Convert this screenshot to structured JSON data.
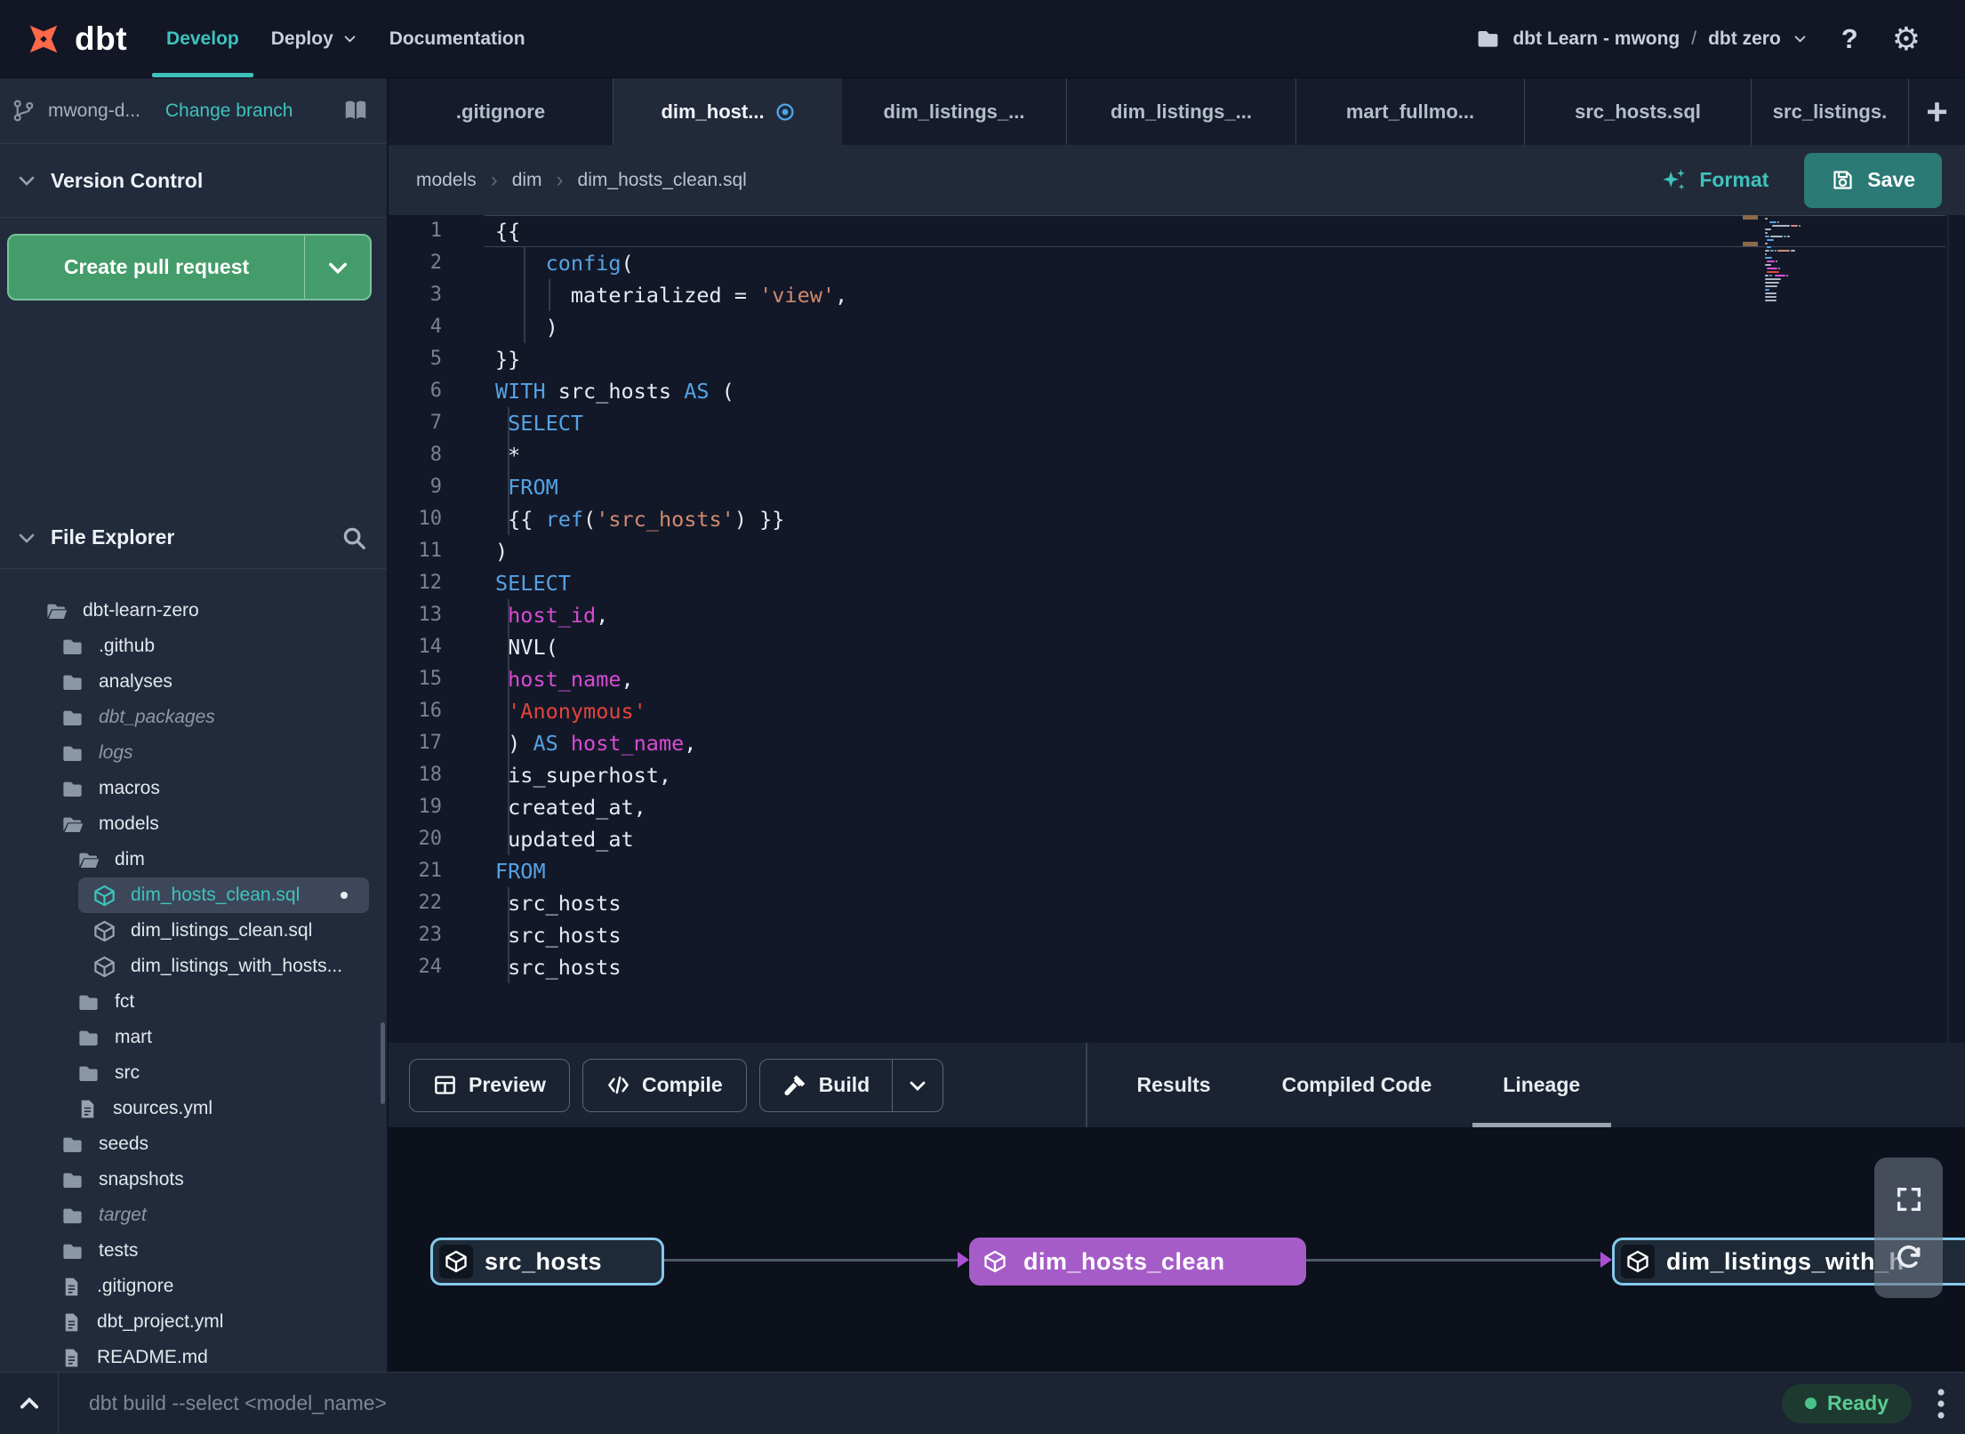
{
  "topbar": {
    "logo_text": "dbt",
    "nav": [
      {
        "label": "Develop",
        "active": true,
        "caret": false
      },
      {
        "label": "Deploy",
        "active": false,
        "caret": true
      },
      {
        "label": "Documentation",
        "active": false,
        "caret": false
      }
    ],
    "project": {
      "workspace": "dbt Learn - mwong",
      "separator": "/",
      "environment": "dbt zero"
    },
    "help_label": "?",
    "gear_glyph": "⚙"
  },
  "sidebar": {
    "branch": {
      "name": "mwong-d...",
      "change_branch_label": "Change branch"
    },
    "version_control": {
      "title": "Version Control",
      "create_pr_label": "Create pull request"
    },
    "file_explorer": {
      "title": "File Explorer",
      "tree": [
        {
          "label": "dbt-learn-zero",
          "icon": "folder-open",
          "level": 0
        },
        {
          "label": ".github",
          "icon": "folder",
          "level": 1
        },
        {
          "label": "analyses",
          "icon": "folder",
          "level": 1
        },
        {
          "label": "dbt_packages",
          "icon": "folder",
          "level": 1,
          "muted": true
        },
        {
          "label": "logs",
          "icon": "folder",
          "level": 1,
          "muted": true
        },
        {
          "label": "macros",
          "icon": "folder",
          "level": 1
        },
        {
          "label": "models",
          "icon": "folder-open",
          "level": 1
        },
        {
          "label": "dim",
          "icon": "folder-open",
          "level": 2
        },
        {
          "label": "dim_hosts_clean.sql",
          "icon": "model",
          "level": 3,
          "selected": true,
          "modified": true
        },
        {
          "label": "dim_listings_clean.sql",
          "icon": "model",
          "level": 3
        },
        {
          "label": "dim_listings_with_hosts...",
          "icon": "model",
          "level": 3
        },
        {
          "label": "fct",
          "icon": "folder",
          "level": 2
        },
        {
          "label": "mart",
          "icon": "folder",
          "level": 2
        },
        {
          "label": "src",
          "icon": "folder",
          "level": 2
        },
        {
          "label": "sources.yml",
          "icon": "file",
          "level": 2
        },
        {
          "label": "seeds",
          "icon": "folder",
          "level": 1
        },
        {
          "label": "snapshots",
          "icon": "folder",
          "level": 1
        },
        {
          "label": "target",
          "icon": "folder",
          "level": 1,
          "muted": true
        },
        {
          "label": "tests",
          "icon": "folder",
          "level": 1
        },
        {
          "label": ".gitignore",
          "icon": "file",
          "level": 1
        },
        {
          "label": "dbt_project.yml",
          "icon": "file",
          "level": 1
        },
        {
          "label": "README.md",
          "icon": "file",
          "level": 1
        }
      ]
    }
  },
  "tabs": {
    "items": [
      {
        "label": ".gitignore"
      },
      {
        "label": "dim_host...",
        "active": true,
        "dirty": true
      },
      {
        "label": "dim_listings_..."
      },
      {
        "label": "dim_listings_..."
      },
      {
        "label": "mart_fullmo..."
      },
      {
        "label": "src_hosts.sql"
      },
      {
        "label": "src_listings."
      }
    ],
    "add_label": "+"
  },
  "breadcrumb": {
    "parts": [
      "models",
      "dim",
      "dim_hosts_clean.sql"
    ],
    "separator": "›"
  },
  "actions": {
    "format_label": "Format",
    "save_label": "Save"
  },
  "editor": {
    "lines": [
      [
        [
          "{{",
          "p"
        ]
      ],
      [
        [
          "    ",
          "p"
        ],
        [
          "config",
          "k"
        ],
        [
          "(",
          "p"
        ]
      ],
      [
        [
          "      ",
          "p"
        ],
        [
          "materialized = ",
          "p"
        ],
        [
          "'view'",
          "s"
        ],
        [
          ",",
          "p"
        ]
      ],
      [
        [
          "    )",
          "p"
        ]
      ],
      [
        [
          "}}",
          "p"
        ]
      ],
      [
        [
          "WITH",
          "k"
        ],
        [
          " src_hosts ",
          "p"
        ],
        [
          "AS",
          "k"
        ],
        [
          " (",
          "p"
        ]
      ],
      [
        [
          " ",
          "p"
        ],
        [
          "SELECT",
          "k"
        ]
      ],
      [
        [
          " *",
          "p"
        ]
      ],
      [
        [
          " ",
          "p"
        ],
        [
          "FROM",
          "k"
        ]
      ],
      [
        [
          " {{ ",
          "p"
        ],
        [
          "ref",
          "k"
        ],
        [
          "(",
          "p"
        ],
        [
          "'src_hosts'",
          "s"
        ],
        [
          ") }}",
          "p"
        ]
      ],
      [
        [
          ")",
          "p"
        ]
      ],
      [
        [
          "SELECT",
          "k"
        ]
      ],
      [
        [
          " ",
          "p"
        ],
        [
          "host_id",
          "i"
        ],
        [
          ",",
          "p"
        ]
      ],
      [
        [
          " NVL(",
          "p"
        ]
      ],
      [
        [
          " ",
          "p"
        ],
        [
          "host_name",
          "i"
        ],
        [
          ",",
          "p"
        ]
      ],
      [
        [
          " ",
          "p"
        ],
        [
          "'Anonymous'",
          "r"
        ]
      ],
      [
        [
          " ) ",
          "p"
        ],
        [
          "AS",
          "k"
        ],
        [
          " ",
          "p"
        ],
        [
          "host_name",
          "i"
        ],
        [
          ",",
          "p"
        ]
      ],
      [
        [
          " is_superhost,",
          "p"
        ]
      ],
      [
        [
          " created_at,",
          "p"
        ]
      ],
      [
        [
          " updated_at",
          "p"
        ]
      ],
      [
        [
          "FROM",
          "k"
        ]
      ],
      [
        [
          " src_hosts",
          "p"
        ]
      ],
      [
        [
          " src_hosts",
          "p"
        ]
      ],
      [
        [
          " src_hosts",
          "p"
        ]
      ]
    ]
  },
  "bottom_panel": {
    "run_buttons": [
      {
        "label": "Preview",
        "icon": "grid"
      },
      {
        "label": "Compile",
        "icon": "code"
      },
      {
        "label": "Build",
        "icon": "hammer",
        "split": true
      }
    ],
    "tabs": [
      {
        "label": "Results"
      },
      {
        "label": "Compiled Code"
      },
      {
        "label": "Lineage",
        "active": true
      }
    ]
  },
  "lineage": {
    "nodes": [
      {
        "label": "src_hosts",
        "style": "source"
      },
      {
        "label": "dim_hosts_clean",
        "style": "model-sel"
      },
      {
        "label": "dim_listings_with_h",
        "style": "source"
      }
    ]
  },
  "statusbar": {
    "command": "dbt build --select <model_name>",
    "status_label": "Ready"
  },
  "colors": {
    "accent_teal": "#3fc2bc",
    "save_teal": "#2b7a75",
    "pr_green": "#459c6b",
    "ready_green": "#49c289",
    "node_cyan": "#84c9eb",
    "node_purple": "#a55cc8",
    "arrow_purple": "#ac4fd4",
    "dirty_blue": "#4ba6e8"
  }
}
